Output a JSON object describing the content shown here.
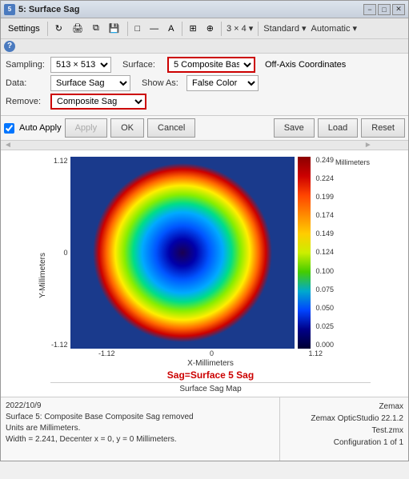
{
  "window": {
    "title": "5: Surface Sag",
    "title_icon": "5"
  },
  "title_controls": {
    "minimize": "−",
    "maximize": "□",
    "close": "✕"
  },
  "toolbar": {
    "settings_label": "Settings",
    "grid_label": "3 × 4 ▾",
    "standard_label": "Standard ▾",
    "automatic_label": "Automatic ▾"
  },
  "controls": {
    "sampling_label": "Sampling:",
    "sampling_value": "513 × 513",
    "surface_label": "Surface:",
    "surface_value": "5 Composite Bas",
    "offaxis_label": "Off-Axis Coordinates",
    "data_label": "Data:",
    "data_value": "Surface Sag",
    "showas_label": "Show As:",
    "showas_value": "False Color",
    "remove_label": "Remove:",
    "remove_value": "Composite Sag"
  },
  "buttons": {
    "auto_apply_label": "Auto Apply",
    "apply_label": "Apply",
    "ok_label": "OK",
    "cancel_label": "Cancel",
    "save_label": "Save",
    "load_label": "Load",
    "reset_label": "Reset"
  },
  "chart": {
    "y_label": "Y-Millimeters",
    "x_label": "X-Millimeters",
    "y_max": "1.12",
    "y_mid": "0",
    "y_min": "-1.12",
    "x_min": "-1.12",
    "x_mid": "0",
    "x_max": "1.12",
    "title": "Sag=Surface 5 Sag",
    "map_label": "Surface Sag Map",
    "colorbar_labels": [
      "0.249",
      "0.224",
      "0.199",
      "0.174",
      "0.149",
      "0.124",
      "0.100",
      "0.075",
      "0.050",
      "0.025",
      "0.000"
    ],
    "colorbar_unit": "Millimeters"
  },
  "info": {
    "left_line1": "2022/10/9",
    "left_line2": "Surface 5: Composite Base Composite Sag removed",
    "left_line3": "Units are Millimeters.",
    "left_line4": "",
    "left_line5": "Width = 2.241, Decenter x = 0, y = 0 Millimeters.",
    "right_line1": "Zemax",
    "right_line2": "Zemax OpticStudio 22.1.2",
    "right_line3": "",
    "right_line4": "Test.zmx",
    "right_line5": "Configuration 1 of 1"
  }
}
